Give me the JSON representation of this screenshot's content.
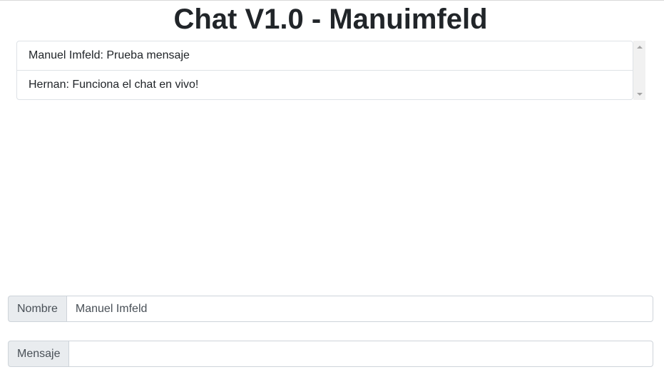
{
  "page": {
    "title": "Chat V1.0 - Manuimfeld"
  },
  "chat": {
    "messages": [
      {
        "text": "Manuel Imfeld: Prueba mensaje"
      },
      {
        "text": "Hernan: Funciona el chat en vivo!"
      }
    ]
  },
  "form": {
    "nombre_label": "Nombre",
    "nombre_value": "Manuel Imfeld",
    "mensaje_label": "Mensaje",
    "mensaje_value": ""
  },
  "icons": {
    "scroll_up": "scroll-up-arrow-icon",
    "scroll_down": "scroll-down-arrow-icon"
  },
  "colors": {
    "addon_background": "#e9ecef",
    "border": "#ced4da",
    "text": "#212529"
  }
}
